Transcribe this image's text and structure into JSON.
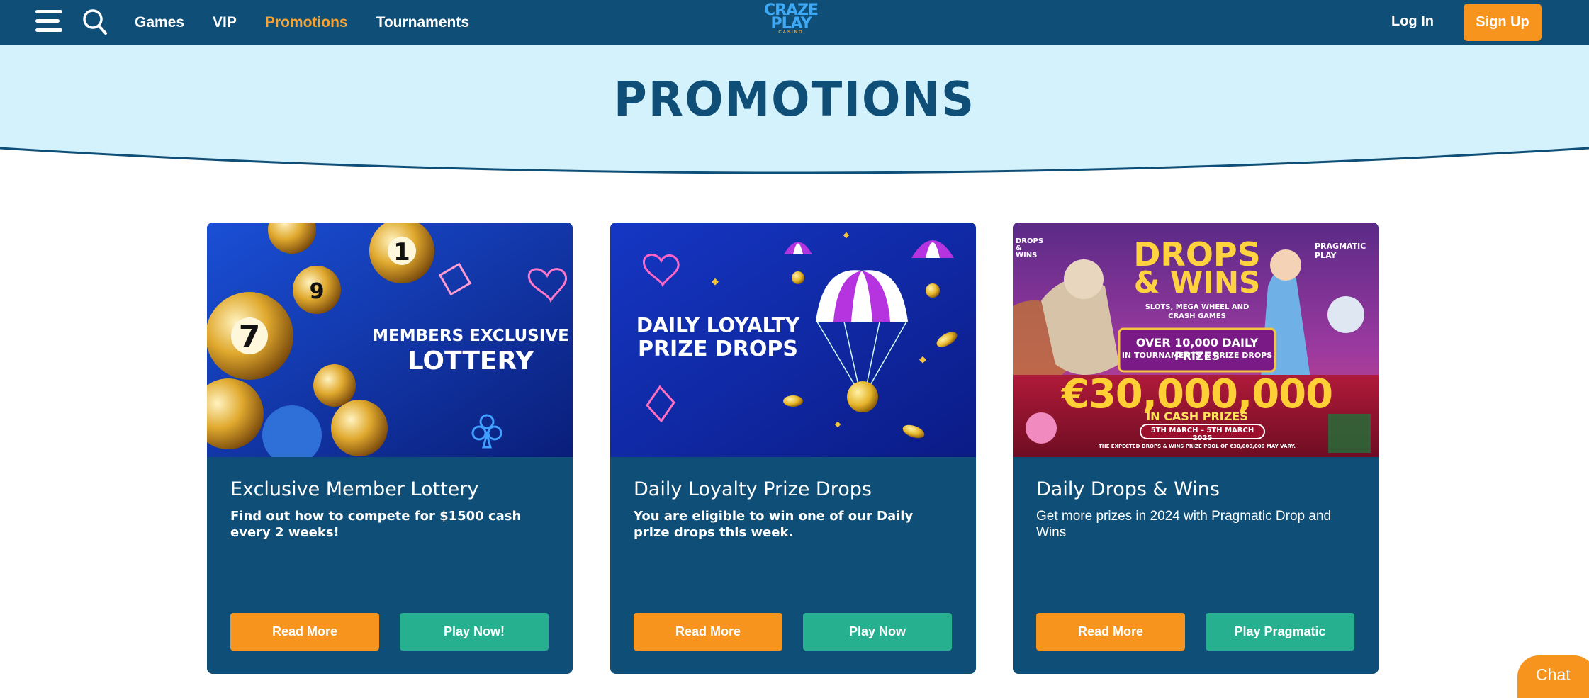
{
  "nav": {
    "links": [
      {
        "label": "Games",
        "active": false
      },
      {
        "label": "VIP",
        "active": false
      },
      {
        "label": "Promotions",
        "active": true
      },
      {
        "label": "Tournaments",
        "active": false
      }
    ],
    "logo": {
      "line1": "CRAZE",
      "line2": "PLAY",
      "line3": "CASINO"
    },
    "login_label": "Log In",
    "signup_label": "Sign Up"
  },
  "hero": {
    "title": "PROMOTIONS"
  },
  "cards": [
    {
      "image": {
        "line1": "MEMBERS EXCLUSIVE",
        "line2": "LOTTERY"
      },
      "title": "Exclusive Member Lottery",
      "description": "Find out how to compete for $1500 cash every 2 weeks!",
      "read_label": "Read More",
      "play_label": "Play Now!"
    },
    {
      "image": {
        "line1": "DAILY LOYALTY",
        "line2": "PRIZE DROPS"
      },
      "title": "Daily Loyalty Prize Drops",
      "description": "You are eligible to win one of our Daily prize drops this week.",
      "read_label": "Read More",
      "play_label": "Play Now"
    },
    {
      "image": {
        "badge": "DROPS & WINS",
        "brand": "PRAGMATIC PLAY",
        "headline1": "DROPS",
        "headline2": "& WINS",
        "sub": "SLOTS, MEGA WHEEL AND CRASH GAMES",
        "prizes1": "OVER 10,000 DAILY PRIZES",
        "prizes2": "IN TOURNAMENTS & PRIZE DROPS",
        "amount": "€30,000,000",
        "cash": "IN CASH PRIZES",
        "dates": "5TH MARCH – 5TH MARCH 2025",
        "fine": "THE EXPECTED DROPS & WINS PRIZE POOL OF €30,000,000 MAY VARY."
      },
      "title": "Daily Drops & Wins",
      "description": "Get more prizes in 2024 with Pragmatic Drop and Wins",
      "read_label": "Read More",
      "play_label": "Play Pragmatic"
    }
  ],
  "chat_label": "Chat",
  "colors": {
    "nav_bg": "#0f4f77",
    "accent_orange": "#f7941d",
    "accent_green": "#26b08f",
    "hero_bg": "#d3f2fc"
  }
}
